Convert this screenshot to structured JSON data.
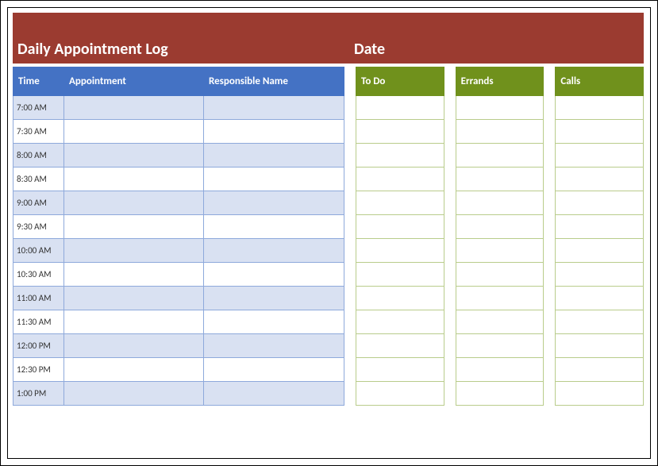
{
  "header": {
    "title_left": "Daily Appointment Log",
    "title_right": "Date"
  },
  "appointments": {
    "columns": {
      "time": "Time",
      "appointment": "Appointment",
      "responsible": "Responsible Name"
    },
    "rows": [
      {
        "time": "7:00 AM",
        "appointment": "",
        "responsible": ""
      },
      {
        "time": "7:30 AM",
        "appointment": "",
        "responsible": ""
      },
      {
        "time": "8:00 AM",
        "appointment": "",
        "responsible": ""
      },
      {
        "time": "8:30 AM",
        "appointment": "",
        "responsible": ""
      },
      {
        "time": "9:00 AM",
        "appointment": "",
        "responsible": ""
      },
      {
        "time": "9:30 AM",
        "appointment": "",
        "responsible": ""
      },
      {
        "time": "10:00 AM",
        "appointment": "",
        "responsible": ""
      },
      {
        "time": "10:30 AM",
        "appointment": "",
        "responsible": ""
      },
      {
        "time": "11:00 AM",
        "appointment": "",
        "responsible": ""
      },
      {
        "time": "11:30 AM",
        "appointment": "",
        "responsible": ""
      },
      {
        "time": "12:00 PM",
        "appointment": "",
        "responsible": ""
      },
      {
        "time": "12:30 PM",
        "appointment": "",
        "responsible": ""
      },
      {
        "time": "1:00 PM",
        "appointment": "",
        "responsible": ""
      }
    ]
  },
  "side": {
    "todo": {
      "header": "To Do",
      "row_count": 13
    },
    "errands": {
      "header": "Errands",
      "row_count": 13
    },
    "calls": {
      "header": "Calls",
      "row_count": 13
    }
  },
  "colors": {
    "header_bar": "#9b3b30",
    "table_header_blue": "#4472c4",
    "table_border_blue": "#8ea9db",
    "table_row_even": "#d9e1f2",
    "side_header_green": "#70911c",
    "side_border_green": "#b9cc8b"
  }
}
